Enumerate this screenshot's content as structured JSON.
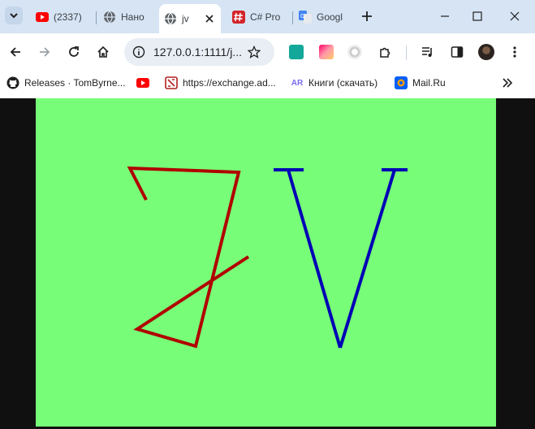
{
  "browser": {
    "tabs": [
      {
        "title": "(2337)",
        "favicon": "youtube-icon"
      },
      {
        "title": "Нано",
        "favicon": "globe-icon"
      },
      {
        "title": "jv",
        "favicon": "globe-icon",
        "active": true
      },
      {
        "title": "C# Pro",
        "favicon": "hash-icon"
      },
      {
        "title": "Googl",
        "favicon": "google-translate-icon"
      }
    ],
    "address": "127.0.0.1:1111/j...",
    "bookmarks": [
      {
        "label": "Releases · TomByrne...",
        "favicon": "github-icon"
      },
      {
        "label": "",
        "favicon": "youtube-icon"
      },
      {
        "label": "https://exchange.ad...",
        "favicon": "exchange-icon"
      },
      {
        "label": "Книги (скачать)",
        "favicon": "ar-icon",
        "badge": "AR"
      },
      {
        "label": "Mail.Ru",
        "favicon": "mailru-icon"
      }
    ]
  },
  "page": {
    "background": "#77fd77",
    "letters": [
      {
        "name": "letter-z-drawing",
        "color": "#b00000"
      },
      {
        "name": "letter-v-drawing",
        "color": "#0000b5"
      }
    ]
  }
}
